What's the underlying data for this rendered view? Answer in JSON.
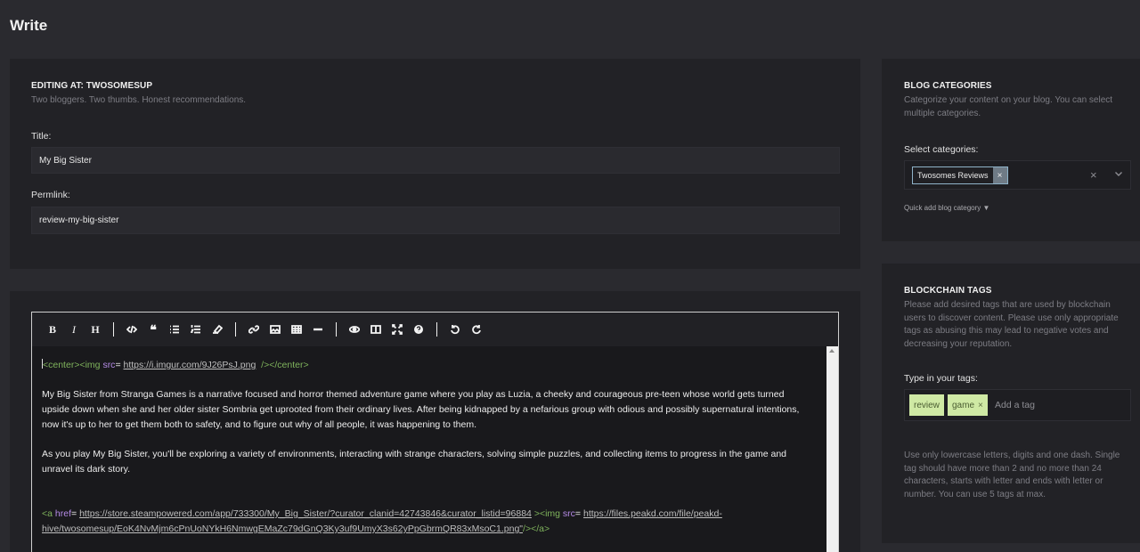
{
  "page": {
    "title": "Write"
  },
  "edit_panel": {
    "heading": "EDITING AT: TWOSOMESUP",
    "subheading": "Two bloggers. Two thumbs. Honest recommendations.",
    "title_label": "Title:",
    "title_value": "My Big Sister",
    "permlink_label": "Permlink:",
    "permlink_value": "review-my-big-sister"
  },
  "editor": {
    "toolbar": [
      "bold-icon",
      "italic-icon",
      "heading-icon",
      "code-icon",
      "quote-icon",
      "bulleted-list-icon",
      "numbered-list-icon",
      "clean-block-icon",
      "link-icon",
      "image-icon",
      "table-icon",
      "horizontal-rule-icon",
      "preview-icon",
      "side-by-side-icon",
      "fullscreen-icon",
      "help-icon",
      "undo-icon",
      "redo-icon"
    ],
    "line1": {
      "open_center": "<center>",
      "img_open": "<img",
      "src_attr": "src",
      "eq": "=",
      "url": "https://i.imgur.com/9J26PsJ.png",
      "close": "/></center>"
    },
    "paragraph1": "My Big Sister from Stranga Games is a narrative focused and horror themed adventure game where you play as Luzia, a cheeky and courageous pre-teen whose world gets turned upside down when she and her older sister Sombria get uprooted from their ordinary lives. After being kidnapped by a nefarious group with odious and possibly supernatural intentions, now it's up to her to get them both to safety, and to figure out why of all people, it was happening to them.",
    "paragraph2": "As you play My Big Sister, you'll be exploring a variety of environments, interacting with strange characters, solving simple puzzles, and collecting items to progress in the game and unravel its dark story.",
    "link_line": {
      "a_open": "<a",
      "href_attr": "href",
      "eq": "=",
      "href_url": "https://store.steampowered.com/app/733300/My_Big_Sister/?curator_clanid=42743846&curator_listid=96884",
      "img_open": "><img",
      "src_attr": "src",
      "src_url_part1": "https://files.peakd.com/file/peakd-",
      "src_url_part2": "hive/twosomesup/EoK4NvMjm6cPnUoNYkH6NmwgEMaZc79dGnQ3Ky3uf9UmyX3s62yPpGbrmQR83xMsoC1.png",
      "tail_quote": "\"",
      "close": "/></a>"
    }
  },
  "categories_panel": {
    "heading": "BLOG CATEGORIES",
    "description": "Categorize your content on your blog. You can select multiple categories.",
    "select_label": "Select categories:",
    "selected": "Twosomes Reviews",
    "chip_remove": "×",
    "clear": "×",
    "quick_add": "Quick add blog category ▼"
  },
  "tags_panel": {
    "heading": "BLOCKCHAIN TAGS",
    "description": "Please add desired tags that are used by blockchain users to discover content. Please use only appropriate tags as abusing this may lead to negative votes and decreasing your reputation.",
    "input_label": "Type in your tags:",
    "tags": [
      "review",
      "game"
    ],
    "tag_remove": "×",
    "placeholder": "Add a tag",
    "rules": "Use only lowercase letters, digits and one dash. Single tag should have more than 2 and no more than 24 characters, starts with letter and ends with letter or number. You can use 5 tags at max."
  },
  "colors": {
    "background": "#2a2a2f",
    "panel": "#222226",
    "tag_bg": "#cfe9a4",
    "code_green": "#7fb35c",
    "code_purple": "#b58be6"
  }
}
